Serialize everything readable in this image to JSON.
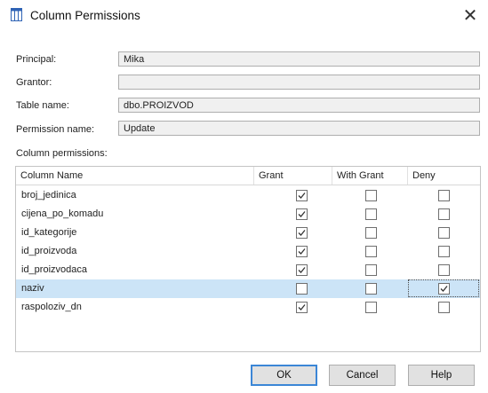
{
  "window": {
    "title": "Column Permissions"
  },
  "fields": [
    {
      "label": "Principal:",
      "value": "Mika"
    },
    {
      "label": "Grantor:",
      "value": ""
    },
    {
      "label": "Table name:",
      "value": "dbo.PROIZVOD"
    },
    {
      "label": "Permission name:",
      "value": "Update"
    }
  ],
  "column_permissions": {
    "label": "Column permissions:",
    "headers": [
      "Column Name",
      "Grant",
      "With Grant",
      "Deny"
    ],
    "rows": [
      {
        "name": "broj_jedinica",
        "grant": true,
        "with_grant": false,
        "deny": false,
        "selected": false
      },
      {
        "name": "cijena_po_komadu",
        "grant": true,
        "with_grant": false,
        "deny": false,
        "selected": false
      },
      {
        "name": "id_kategorije",
        "grant": true,
        "with_grant": false,
        "deny": false,
        "selected": false
      },
      {
        "name": "id_proizvoda",
        "grant": true,
        "with_grant": false,
        "deny": false,
        "selected": false
      },
      {
        "name": "id_proizvodaca",
        "grant": true,
        "with_grant": false,
        "deny": false,
        "selected": false
      },
      {
        "name": "naziv",
        "grant": false,
        "with_grant": false,
        "deny": true,
        "selected": true
      },
      {
        "name": "raspoloziv_dn",
        "grant": true,
        "with_grant": false,
        "deny": false,
        "selected": false
      }
    ]
  },
  "buttons": {
    "ok": "OK",
    "cancel": "Cancel",
    "help": "Help"
  },
  "colors": {
    "selection": "#cce4f7",
    "default_button_border": "#3b86d6",
    "readonly_field": "#f0f0f0"
  }
}
